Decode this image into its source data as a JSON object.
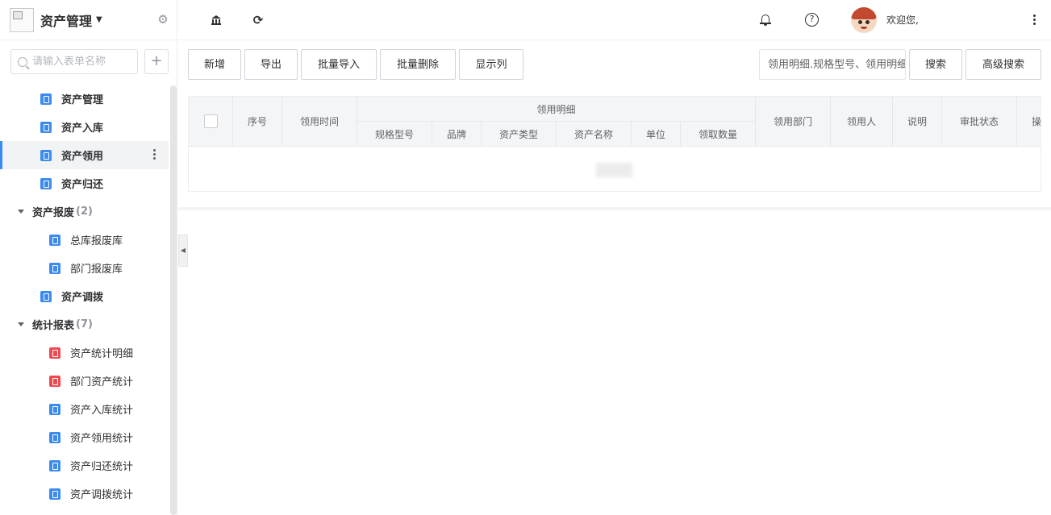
{
  "sidebar": {
    "app_title": "资产管理",
    "search_placeholder": "请输入表单名称",
    "items": [
      {
        "label": "资产管理",
        "level": 1,
        "icon": "form-icon",
        "color": "#3c8cf0"
      },
      {
        "label": "资产入库",
        "level": 1,
        "icon": "form-icon",
        "color": "#3c8cf0"
      },
      {
        "label": "资产领用",
        "level": 1,
        "icon": "form-icon",
        "color": "#3c8cf0",
        "active": true
      },
      {
        "label": "资产归还",
        "level": 1,
        "icon": "form-icon",
        "color": "#3c8cf0"
      },
      {
        "label": "资产报废",
        "level": 0,
        "count": "(2)",
        "expanded": true
      },
      {
        "label": "总库报废库",
        "level": 2,
        "icon": "form-icon",
        "color": "#3c8cf0"
      },
      {
        "label": "部门报废库",
        "level": 2,
        "icon": "form-icon",
        "color": "#3c8cf0"
      },
      {
        "label": "资产调拨",
        "level": 1,
        "icon": "form-icon",
        "color": "#3c8cf0"
      },
      {
        "label": "统计报表",
        "level": 0,
        "count": "(7)",
        "expanded": true
      },
      {
        "label": "资产统计明细",
        "level": 2,
        "icon": "report-icon",
        "color": "#ee4a4f"
      },
      {
        "label": "部门资产统计",
        "level": 2,
        "icon": "report-icon",
        "color": "#ee4a4f"
      },
      {
        "label": "资产入库统计",
        "level": 2,
        "icon": "form-icon",
        "color": "#3c8cf0"
      },
      {
        "label": "资产领用统计",
        "level": 2,
        "icon": "form-icon",
        "color": "#3c8cf0"
      },
      {
        "label": "资产归还统计",
        "level": 2,
        "icon": "form-icon",
        "color": "#3c8cf0"
      },
      {
        "label": "资产调拨统计",
        "level": 2,
        "icon": "form-icon",
        "color": "#3c8cf0"
      }
    ]
  },
  "header": {
    "welcome": "欢迎您,"
  },
  "toolbar": {
    "buttons": [
      "新增",
      "导出",
      "批量导入",
      "批量删除",
      "显示列"
    ],
    "search_placeholder": "领用明细.规格型号、领用明细",
    "search_label": "搜索",
    "advanced_search_label": "高级搜索"
  },
  "table": {
    "columns": {
      "index": "序号",
      "date": "领用时间",
      "group": "领用明细",
      "sub": [
        "规格型号",
        "品牌",
        "资产类型",
        "资产名称",
        "单位",
        "领取数量"
      ],
      "dept": "领用部门",
      "person": "领用人",
      "note": "说明",
      "status": "审批状态",
      "op": "操"
    }
  },
  "colors": {
    "accent": "#3c8cf0",
    "report_red": "#ee4a4f"
  }
}
